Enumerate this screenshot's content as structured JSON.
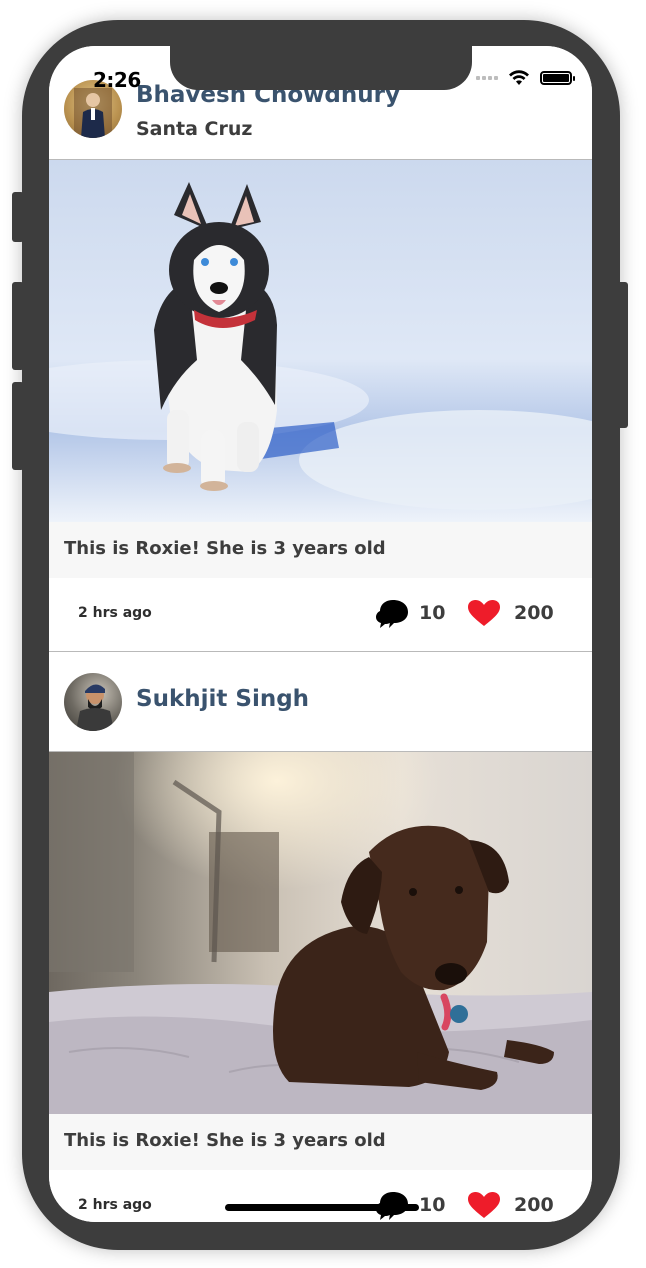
{
  "status_bar": {
    "time": "2:26"
  },
  "posts": [
    {
      "author": "Bhavesh Chowdhury",
      "location": "Santa Cruz",
      "caption": "This is Roxie! She is 3 years old",
      "time_ago": "2 hrs ago",
      "comments": "10",
      "likes": "200"
    },
    {
      "author": "Sukhjit Singh",
      "caption": "This is Roxie! She is 3 years old",
      "time_ago": "2 hrs ago",
      "comments": "10",
      "likes": "200"
    }
  ],
  "icons": {
    "comment": "comment-bubbles-icon",
    "like": "heart-icon",
    "wifi": "wifi-icon",
    "battery": "battery-icon",
    "signal": "signal-icon"
  },
  "colors": {
    "author_name": "#3a536e",
    "text": "#3d3d3d",
    "heart": "#ee1c2a",
    "device_frame": "#3d3d3d"
  }
}
